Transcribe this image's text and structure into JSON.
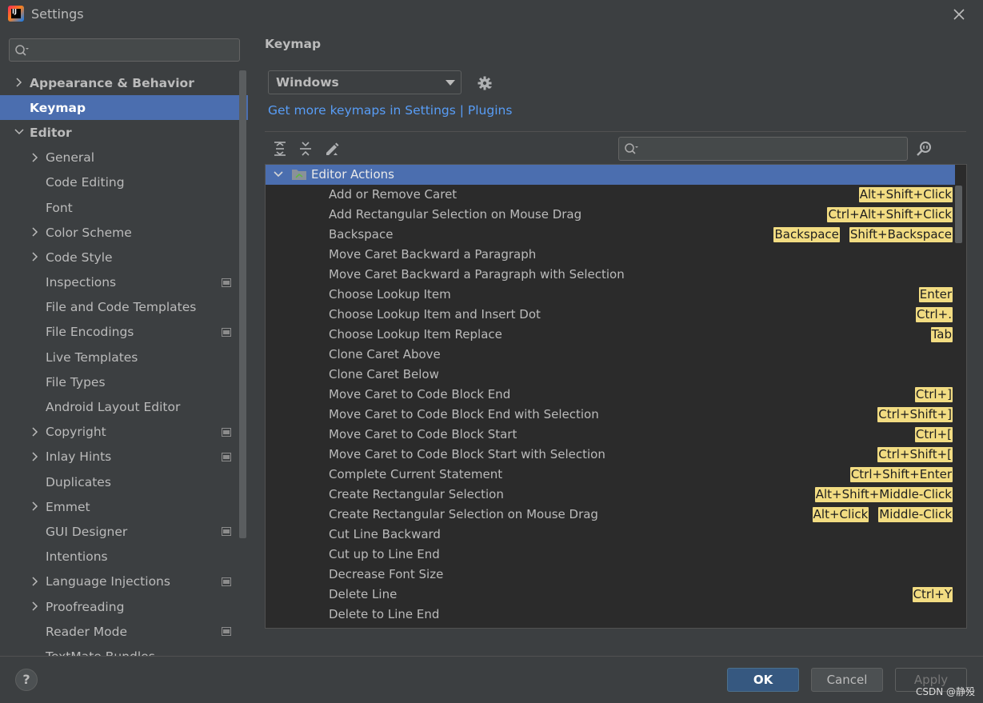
{
  "window": {
    "title": "Settings",
    "logo_text": "IJ"
  },
  "sidebar": {
    "search_placeholder": "",
    "items": [
      {
        "label": "Appearance & Behavior",
        "level": 0,
        "expandable": true,
        "expanded": false,
        "bold": true
      },
      {
        "label": "Keymap",
        "level": 0,
        "expandable": false,
        "bold": true,
        "selected": true
      },
      {
        "label": "Editor",
        "level": 0,
        "expandable": true,
        "expanded": true,
        "bold": true
      },
      {
        "label": "General",
        "level": 1,
        "expandable": true
      },
      {
        "label": "Code Editing",
        "level": 1
      },
      {
        "label": "Font",
        "level": 1
      },
      {
        "label": "Color Scheme",
        "level": 1,
        "expandable": true
      },
      {
        "label": "Code Style",
        "level": 1,
        "expandable": true
      },
      {
        "label": "Inspections",
        "level": 1,
        "project": true
      },
      {
        "label": "File and Code Templates",
        "level": 1
      },
      {
        "label": "File Encodings",
        "level": 1,
        "project": true
      },
      {
        "label": "Live Templates",
        "level": 1
      },
      {
        "label": "File Types",
        "level": 1
      },
      {
        "label": "Android Layout Editor",
        "level": 1
      },
      {
        "label": "Copyright",
        "level": 1,
        "expandable": true,
        "project": true
      },
      {
        "label": "Inlay Hints",
        "level": 1,
        "expandable": true,
        "project": true
      },
      {
        "label": "Duplicates",
        "level": 1
      },
      {
        "label": "Emmet",
        "level": 1,
        "expandable": true
      },
      {
        "label": "GUI Designer",
        "level": 1,
        "project": true
      },
      {
        "label": "Intentions",
        "level": 1
      },
      {
        "label": "Language Injections",
        "level": 1,
        "expandable": true,
        "project": true
      },
      {
        "label": "Proofreading",
        "level": 1,
        "expandable": true
      },
      {
        "label": "Reader Mode",
        "level": 1,
        "project": true
      },
      {
        "label": "TextMate Bundles",
        "level": 1
      }
    ]
  },
  "main": {
    "title": "Keymap",
    "keymap_selected": "Windows",
    "more_keymaps_link": "Get more keymaps in Settings | Plugins",
    "filter_placeholder": "",
    "group": "Editor Actions",
    "actions": [
      {
        "name": "Add or Remove Caret",
        "shortcuts": [
          "Alt+Shift+Click"
        ]
      },
      {
        "name": "Add Rectangular Selection on Mouse Drag",
        "shortcuts": [
          "Ctrl+Alt+Shift+Click"
        ]
      },
      {
        "name": "Backspace",
        "shortcuts": [
          "Backspace",
          "Shift+Backspace"
        ]
      },
      {
        "name": "Move Caret Backward a Paragraph",
        "shortcuts": []
      },
      {
        "name": "Move Caret Backward a Paragraph with Selection",
        "shortcuts": []
      },
      {
        "name": "Choose Lookup Item",
        "shortcuts": [
          "Enter"
        ]
      },
      {
        "name": "Choose Lookup Item and Insert Dot",
        "shortcuts": [
          "Ctrl+."
        ]
      },
      {
        "name": "Choose Lookup Item Replace",
        "shortcuts": [
          "Tab"
        ]
      },
      {
        "name": "Clone Caret Above",
        "shortcuts": []
      },
      {
        "name": "Clone Caret Below",
        "shortcuts": []
      },
      {
        "name": "Move Caret to Code Block End",
        "shortcuts": [
          "Ctrl+]"
        ]
      },
      {
        "name": "Move Caret to Code Block End with Selection",
        "shortcuts": [
          "Ctrl+Shift+]"
        ]
      },
      {
        "name": "Move Caret to Code Block Start",
        "shortcuts": [
          "Ctrl+["
        ]
      },
      {
        "name": "Move Caret to Code Block Start with Selection",
        "shortcuts": [
          "Ctrl+Shift+["
        ]
      },
      {
        "name": "Complete Current Statement",
        "shortcuts": [
          "Ctrl+Shift+Enter"
        ]
      },
      {
        "name": "Create Rectangular Selection",
        "shortcuts": [
          "Alt+Shift+Middle-Click"
        ]
      },
      {
        "name": "Create Rectangular Selection on Mouse Drag",
        "shortcuts": [
          "Alt+Click",
          "Middle-Click"
        ]
      },
      {
        "name": "Cut Line Backward",
        "shortcuts": []
      },
      {
        "name": "Cut up to Line End",
        "shortcuts": []
      },
      {
        "name": "Decrease Font Size",
        "shortcuts": []
      },
      {
        "name": "Delete Line",
        "shortcuts": [
          "Ctrl+Y"
        ]
      },
      {
        "name": "Delete to Line End",
        "shortcuts": []
      }
    ]
  },
  "footer": {
    "help_label": "?",
    "ok_label": "OK",
    "cancel_label": "Cancel",
    "apply_label": "Apply",
    "watermark": "CSDN @静殁"
  },
  "colors": {
    "background": "#3c3f41",
    "selection": "#4b6eaf",
    "link": "#589df6",
    "shortcut_highlight": "#f2dc82",
    "ok_button": "#365880"
  }
}
